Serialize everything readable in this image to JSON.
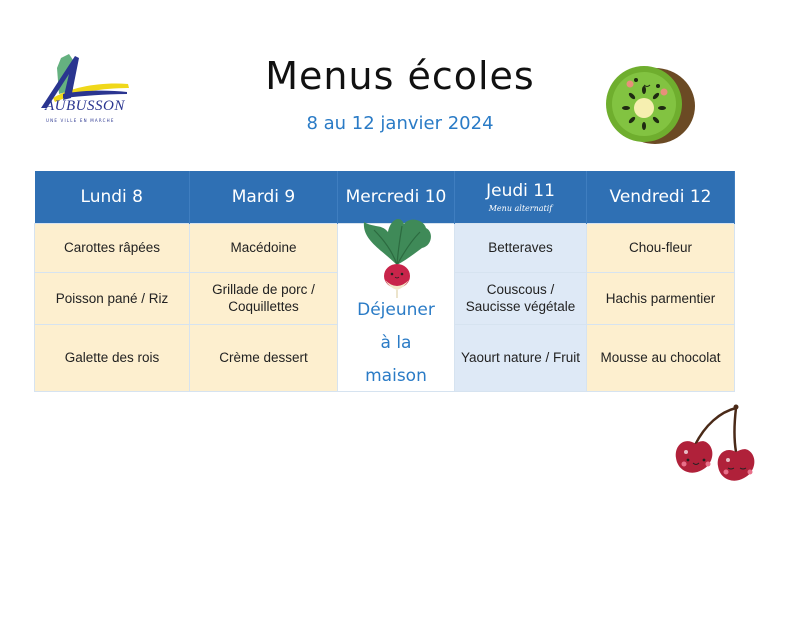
{
  "logo": {
    "name": "AUBUSSON",
    "tagline": "UNE VILLE EN MARCHE"
  },
  "header": {
    "title": "Menus écoles",
    "dates": "8 au 12 janvier 2024"
  },
  "colors": {
    "header_blue": "#2f70b4",
    "cream": "#fdefcf",
    "light_blue": "#dee9f6",
    "accent_blue": "#2a7bc6"
  },
  "days": [
    {
      "label": "Lundi 8",
      "note": ""
    },
    {
      "label": "Mardi 9",
      "note": ""
    },
    {
      "label": "Mercredi 10",
      "note": ""
    },
    {
      "label": "Jeudi 11",
      "note": "Menu alternatif"
    },
    {
      "label": "Vendredi 12",
      "note": ""
    }
  ],
  "rows": [
    [
      "Carottes râpées",
      "Macédoine",
      "Betteraves",
      "Chou-fleur"
    ],
    [
      "Poisson pané / Riz",
      "Grillade de porc / Coquillettes",
      "Couscous / Saucisse végétale",
      "Hachis parmentier"
    ],
    [
      "Galette des rois",
      "Crème dessert",
      "Yaourt nature / Fruit",
      "Mousse au chocolat"
    ]
  ],
  "wednesday": {
    "line1": "Déjeuner",
    "line2": "à la",
    "line3": "maison"
  },
  "decorations": [
    "kiwi-illustration",
    "radish-illustration",
    "cherries-illustration"
  ]
}
